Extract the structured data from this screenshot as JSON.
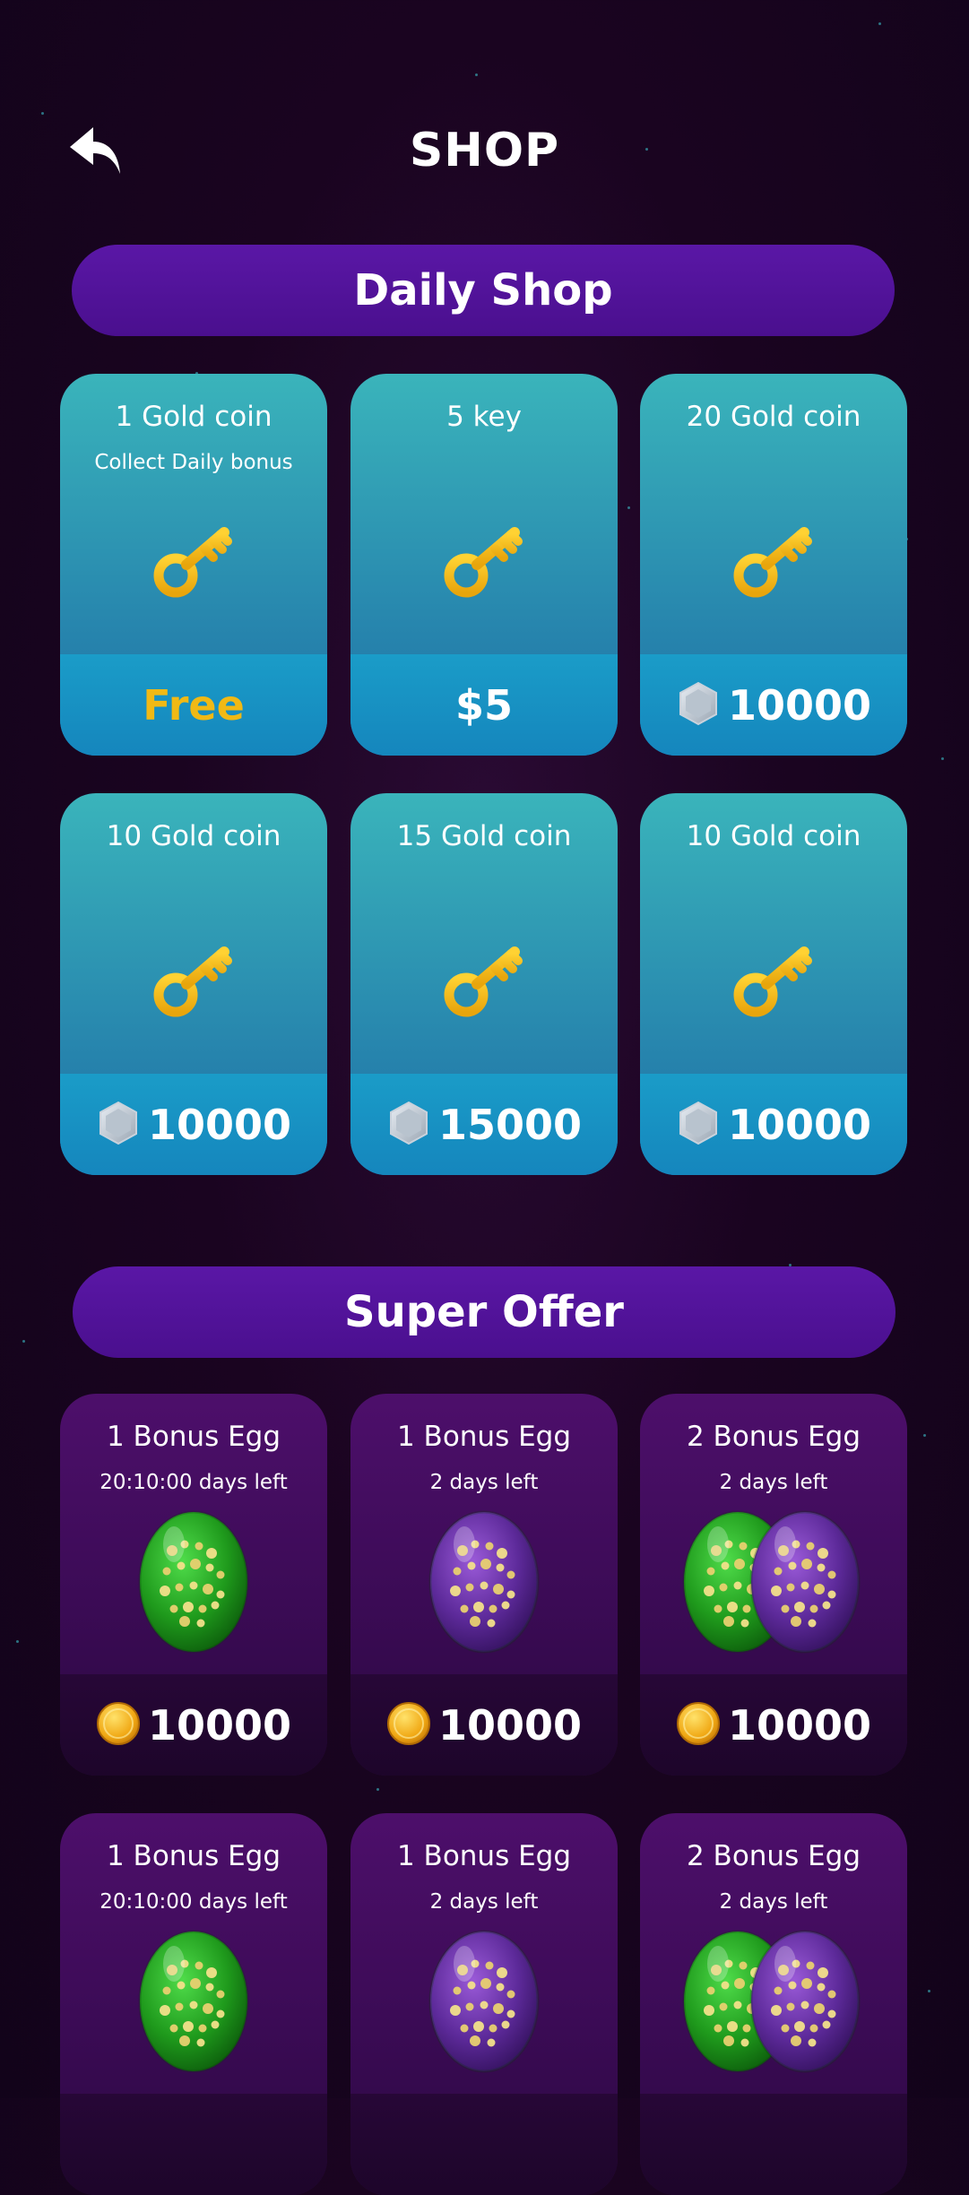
{
  "header": {
    "title": "SHOP",
    "back_icon": "back-arrow-icon"
  },
  "daily": {
    "title": "Daily Shop",
    "items": [
      {
        "name": "1 Gold coin",
        "sub": "Collect Daily bonus",
        "icon": "key-icon",
        "currency": "",
        "price": "Free"
      },
      {
        "name": "5 key",
        "sub": "",
        "icon": "key-icon",
        "currency": "",
        "price": "$5"
      },
      {
        "name": "20 Gold coin",
        "sub": "",
        "icon": "key-icon",
        "currency": "xp-icon",
        "price": "10000"
      },
      {
        "name": "10 Gold coin",
        "sub": "",
        "icon": "key-icon",
        "currency": "xp-icon",
        "price": "10000"
      },
      {
        "name": "15 Gold coin",
        "sub": "",
        "icon": "key-icon",
        "currency": "xp-icon",
        "price": "15000"
      },
      {
        "name": "10 Gold coin",
        "sub": "",
        "icon": "key-icon",
        "currency": "xp-icon",
        "price": "10000"
      }
    ]
  },
  "super": {
    "title": "Super Offer",
    "items": [
      {
        "name": "1 Bonus Egg",
        "sub": "20:10:00 days left",
        "icon": "green-egg-icon",
        "currency": "gold-coin-icon",
        "price": "10000"
      },
      {
        "name": "1 Bonus Egg",
        "sub": "2 days left",
        "icon": "purple-egg-icon",
        "currency": "gold-coin-icon",
        "price": "10000"
      },
      {
        "name": "2 Bonus Egg",
        "sub": "2 days left",
        "icon": "two-eggs-icon",
        "currency": "gold-coin-icon",
        "price": "10000"
      },
      {
        "name": "1 Bonus Egg",
        "sub": "20:10:00 days left",
        "icon": "green-egg-icon",
        "currency": "",
        "price": ""
      },
      {
        "name": "1 Bonus Egg",
        "sub": "2 days left",
        "icon": "purple-egg-icon",
        "currency": "",
        "price": ""
      },
      {
        "name": "2 Bonus Egg",
        "sub": "2 days left",
        "icon": "two-eggs-icon",
        "currency": "",
        "price": ""
      }
    ]
  },
  "colors": {
    "accent": "#f0b915",
    "banner": "#4a0f8e",
    "teal": "#2a8db0"
  }
}
